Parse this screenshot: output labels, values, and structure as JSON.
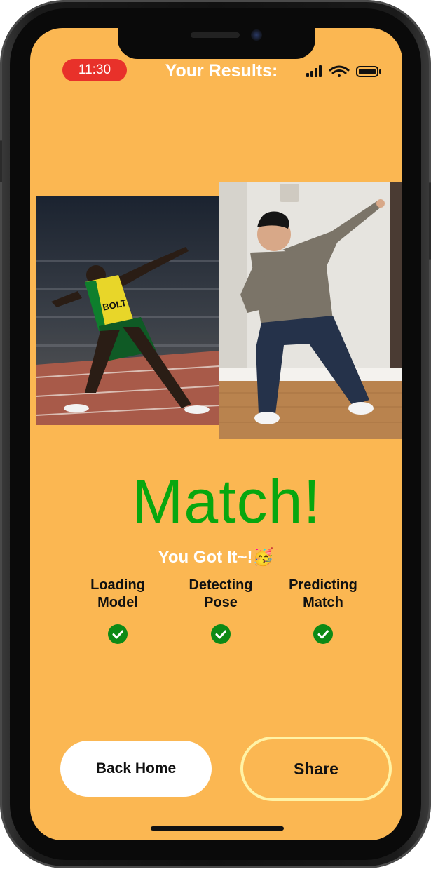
{
  "status_bar": {
    "time": "11:30",
    "icons": [
      "signal-icon",
      "wifi-icon",
      "battery-icon"
    ]
  },
  "header": {
    "title": "Your Results:"
  },
  "photos": {
    "reference": {
      "description_icon": "reference-pose-photo",
      "jersey_text": "BOLT"
    },
    "user": {
      "description_icon": "user-pose-photo"
    }
  },
  "result": {
    "headline": "Match!",
    "subtitle": "You Got It~!🥳",
    "headline_color": "#07a70f"
  },
  "steps": [
    {
      "label": "Loading\nModel",
      "status": "complete"
    },
    {
      "label": "Detecting\nPose",
      "status": "complete"
    },
    {
      "label": "Predicting\nMatch",
      "status": "complete"
    }
  ],
  "actions": {
    "back_home_label": "Back Home",
    "share_label": "Share"
  },
  "colors": {
    "background": "#fbb752",
    "time_pill": "#e8312a",
    "check": "#0d8a16",
    "share_border": "#fff3a6"
  }
}
